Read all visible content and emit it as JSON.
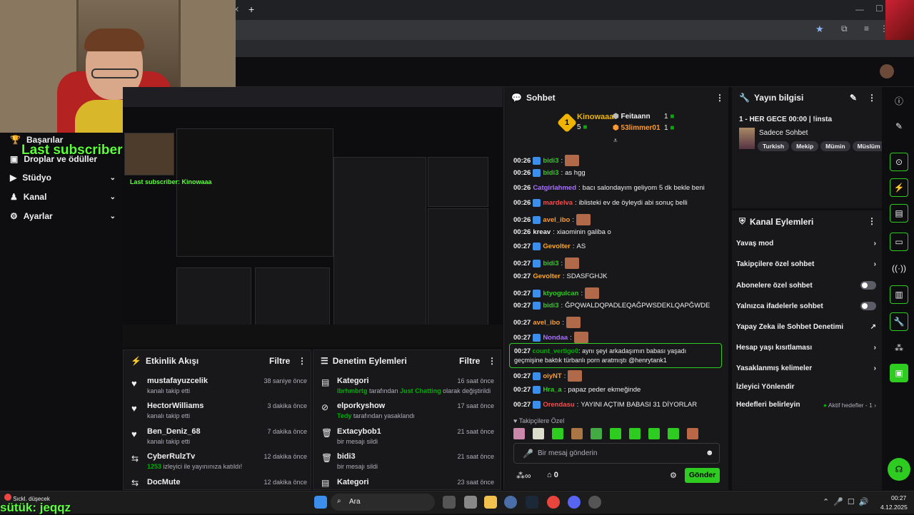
{
  "overlay": {
    "last_subscriber": "Last subscriber: Kinowaaa",
    "bottom_user": "sütük: jeqqz",
    "notification": "Sıckl. düşecek"
  },
  "nav": {
    "items": [
      {
        "label": "Başarılar",
        "icon": "trophy-icon"
      },
      {
        "label": "Droplar ve ödüller",
        "icon": "gift-icon"
      },
      {
        "label": "Stüdyo",
        "icon": "video-icon"
      },
      {
        "label": "Kanal",
        "icon": "person-icon"
      },
      {
        "label": "Ayarlar",
        "icon": "gear-icon"
      }
    ]
  },
  "activity": {
    "title": "Etkinlik Akışı",
    "filter": "Filtre",
    "rows": [
      {
        "name": "mustafayuzcelik",
        "sub": "kanalı takip etti",
        "time": "38 saniye önce"
      },
      {
        "name": "HectorWilliams",
        "sub": "kanalı takip etti",
        "time": "3 dakika önce"
      },
      {
        "name": "Ben_Deniz_68",
        "sub": "kanalı takip etti",
        "time": "7 dakika önce"
      },
      {
        "name": "CyberRulzTv",
        "sub_highlight": "1253",
        "sub": "izleyici ile yayınınıza katıldı!",
        "time": "12 dakika önce"
      },
      {
        "name": "DocMute",
        "sub": "",
        "time": "12 dakika önce"
      }
    ]
  },
  "moderation": {
    "title": "Denetim Eylemleri",
    "filter": "Filtre",
    "rows": [
      {
        "name": "Kategori",
        "sub_user": "lbrhmbrtg",
        "sub_mid": "tarafından",
        "sub_game": "Just Chatting",
        "sub_end": "olarak değiştirildi",
        "time": "16 saat önce"
      },
      {
        "name": "elporkyshow",
        "sub_user": "Tedy",
        "sub_mid": "tarafından yasaklandı",
        "time": "17 saat önce"
      },
      {
        "name": "Extacybob1",
        "sub_mid": "bir mesajı sildi",
        "time": "21 saat önce"
      },
      {
        "name": "bidi3",
        "sub_mid": "bir mesajı sildi",
        "time": "21 saat önce"
      },
      {
        "name": "Kategori",
        "sub_mid": "",
        "time": "23 saat önce"
      }
    ]
  },
  "chat": {
    "title": "Sohbet",
    "leaderboard": {
      "first_name": "Kinowaaa",
      "first_count": "5",
      "rank": "1",
      "second_name": "Feitaann",
      "second_count": "1",
      "third_name": "53limmer01",
      "third_count": "1"
    },
    "messages": [
      {
        "time": "00:26",
        "user": "bidi3",
        "color": "#2ecc20",
        "text": ""
      },
      {
        "time": "00:26",
        "user": "bidi3",
        "color": "#2ecc20",
        "text": "as hgg"
      },
      {
        "time": "00:26",
        "user": "Catgirlahmed",
        "color": "#a970ff",
        "text": "bacı salondayım geliyom 5 dk bekle beni"
      },
      {
        "time": "00:26",
        "user": "mardelva",
        "color": "#ff4a4a",
        "text": "iblisteki ev de öyleydi abi sonuç belli"
      },
      {
        "time": "00:26",
        "user": "avel_ibo",
        "color": "#ff9a2e",
        "text": ""
      },
      {
        "time": "00:26",
        "user": "kreav",
        "color": "#efeff1",
        "text": "xiaominin galiba o"
      },
      {
        "time": "00:27",
        "user": "Gevolter",
        "color": "#ffa726",
        "text": "AS"
      },
      {
        "time": "00:27",
        "user": "bidi3",
        "color": "#2ecc20",
        "text": ""
      },
      {
        "time": "00:27",
        "user": "Gevolter",
        "color": "#ffa726",
        "text": "SDASFGHJK"
      },
      {
        "time": "00:27",
        "user": "ktyogulcan",
        "color": "#2ecc20",
        "text": ""
      },
      {
        "time": "00:27",
        "user": "bidi3",
        "color": "#2ecc20",
        "text": "ĞPQWALDQPADLEQAĞPWSDEKLQAPĞWDE"
      },
      {
        "time": "00:27",
        "user": "avel_ibo",
        "color": "#ff9a2e",
        "text": ""
      },
      {
        "time": "00:27",
        "user": "Nondaa",
        "color": "#a970ff",
        "text": ""
      }
    ],
    "highlight": {
      "time": "00:27",
      "user": "count_vertigo0",
      "text": "aynı şeyi arkadaşımın babası yaşadı geçmişine baktık türbanlı porn aratmıştı @henrytank1"
    },
    "messages2": [
      {
        "time": "00:27",
        "user": "oiyNT",
        "color": "#ff9a2e",
        "text": ""
      },
      {
        "time": "00:27",
        "user": "Hra_a",
        "color": "#2ecc20",
        "text": "papaz peder ekmeğinde"
      },
      {
        "time": "00:27",
        "user": "Orendasu",
        "color": "#ff4a4a",
        "text": "YAYINI AÇTIM BABASI 31 DİYORLAR"
      }
    ],
    "followers_only": "Takipçilere Özel",
    "input_placeholder": "Bir mesaj gönderin",
    "points": "0",
    "send_label": "Gönder"
  },
  "stream_info": {
    "title": "Yayın bilgisi",
    "stream_title": "1 - HER GECE 00:00 | !insta",
    "category": "Sadece Sohbet",
    "tags": [
      "Turkish",
      "Mekip",
      "Mümin",
      "Müslüm"
    ]
  },
  "channel_actions": {
    "title": "Kanal Eylemleri",
    "rows": [
      {
        "label": "Yavaş mod",
        "type": "chevron"
      },
      {
        "label": "Takipçilere özel sohbet",
        "type": "chevron"
      },
      {
        "label": "Abonelere özel sohbet",
        "type": "toggle"
      },
      {
        "label": "Yalnızca ifadelerle sohbet",
        "type": "toggle"
      },
      {
        "label": "Yapay Zeka ile Sohbet Denetimi",
        "type": "external"
      },
      {
        "label": "Hesap yaşı kısıtlaması",
        "type": "chevron"
      },
      {
        "label": "Yasaklanmış kelimeler",
        "type": "chevron"
      },
      {
        "label": "İzleyici Yönlendir",
        "type": "none"
      },
      {
        "label": "Hedefleri belirleyin",
        "type": "status"
      }
    ],
    "goal_status": "Aktif hedefler - 1"
  },
  "taskbar": {
    "search": "Ara",
    "time": "00:27",
    "date": "4.12.2025"
  },
  "colors": {
    "accent": "#2ecc20",
    "bg": "#0e0e10",
    "panel": "#18181b"
  }
}
